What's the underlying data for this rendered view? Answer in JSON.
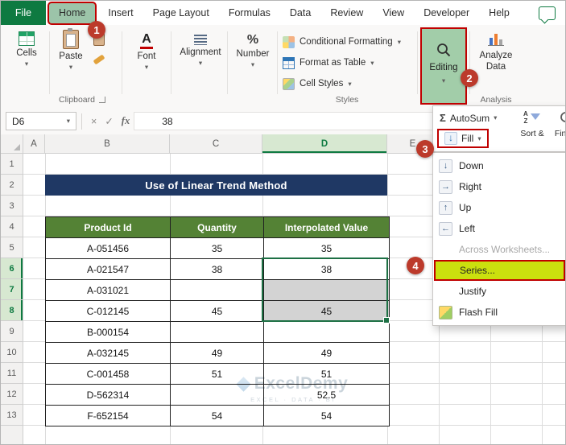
{
  "colors": {
    "excel_green": "#0e7a41",
    "annotation_red": "#c00000",
    "title_navy": "#1f3864",
    "table_header_green": "#548235",
    "selection_green": "#1d7044",
    "series_highlight": "#cbe00e",
    "tab_highlight": "#9cc4a9",
    "gray_cell": "#d3d3d3"
  },
  "icons": {
    "chevron": "▾",
    "cancel": "×",
    "check": "✓",
    "sort_a": "A",
    "sort_z": "Z",
    "font_a": "A",
    "percent": "%"
  },
  "menubar": {
    "file": "File",
    "tabs": [
      "Home",
      "Insert",
      "Page Layout",
      "Formulas",
      "Data",
      "Review",
      "View",
      "Developer",
      "Help"
    ]
  },
  "ribbon": {
    "cells_label": "Cells",
    "paste_label": "Paste",
    "clipboard_group": "Clipboard",
    "font_label": "Font",
    "alignment_label": "Alignment",
    "number_label": "Number",
    "styles": {
      "conditional_formatting": "Conditional Formatting",
      "format_as_table": "Format as Table",
      "cell_styles": "Cell Styles",
      "group_label": "Styles"
    },
    "editing_label": "Editing",
    "analyze_data_label": "Analyze Data",
    "analysis_group": "Analysis"
  },
  "formula_bar": {
    "name_box": "D6",
    "fx_label": "fx",
    "value": "38"
  },
  "editing_panel": {
    "sigma": "Σ",
    "autosum_label": "AutoSum",
    "fill_label": "Fill",
    "sort_label": "Sort &",
    "find_label": "Find &"
  },
  "fill_menu": {
    "items": [
      {
        "label": "Down",
        "glyph": "↓"
      },
      {
        "label": "Right",
        "glyph": "→"
      },
      {
        "label": "Up",
        "glyph": "↑"
      },
      {
        "label": "Left",
        "glyph": "←"
      },
      {
        "label": "Across Worksheets...",
        "glyph": ""
      },
      {
        "label": "Series...",
        "glyph": ""
      },
      {
        "label": "Justify",
        "glyph": ""
      },
      {
        "label": "Flash Fill",
        "glyph": ""
      }
    ]
  },
  "annotations": {
    "step1": "1",
    "step2": "2",
    "step3": "3",
    "step4": "4"
  },
  "sheet": {
    "title": "Use of Linear Trend Method",
    "column_headers": [
      "A",
      "B",
      "C",
      "D",
      "E"
    ],
    "row_headers": [
      "1",
      "2",
      "3",
      "4",
      "5",
      "6",
      "7",
      "8",
      "9",
      "10",
      "11",
      "12",
      "13"
    ],
    "table": {
      "headers": [
        "Product Id",
        "Quantity",
        "Interpolated Value"
      ],
      "rows": [
        {
          "id": "A-051456",
          "qty": "35",
          "interp": "35"
        },
        {
          "id": "A-021547",
          "qty": "38",
          "interp": "38"
        },
        {
          "id": "A-031021",
          "qty": "",
          "interp": ""
        },
        {
          "id": "C-012145",
          "qty": "45",
          "interp": "45"
        },
        {
          "id": "B-000154",
          "qty": "",
          "interp": ""
        },
        {
          "id": "A-032145",
          "qty": "49",
          "interp": "49"
        },
        {
          "id": "C-001458",
          "qty": "51",
          "interp": "51"
        },
        {
          "id": "D-562314",
          "qty": "",
          "interp": "52.5"
        },
        {
          "id": "F-652154",
          "qty": "54",
          "interp": "54"
        }
      ]
    },
    "watermark": {
      "brand": "ExcelDemy",
      "tagline": "EXCEL · DATA · BI"
    }
  }
}
